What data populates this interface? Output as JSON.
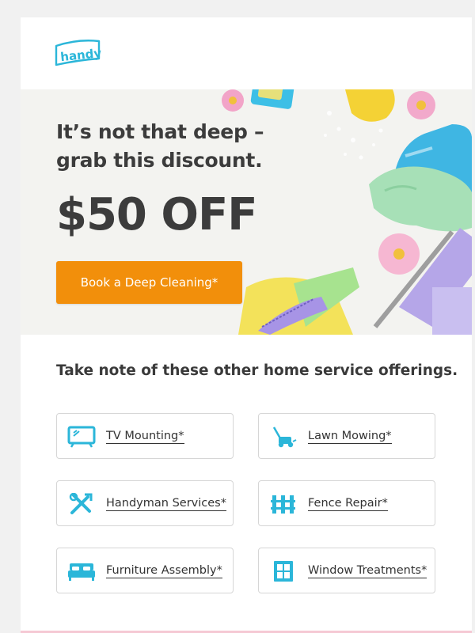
{
  "brand": {
    "name": "handy",
    "color": "#2bb6d9"
  },
  "hero": {
    "headline_line1": "It’s not that deep –",
    "headline_line2": "grab this discount.",
    "offer": "$50 OFF",
    "cta_label": "Book a Deep Cleaning*",
    "cta_color": "#f28f0b"
  },
  "services_section": {
    "title": "Take note of these other home service offerings.",
    "items": [
      {
        "label": "TV Mounting*",
        "icon": "tv-icon"
      },
      {
        "label": "Lawn Mowing*",
        "icon": "lawn-mower-icon"
      },
      {
        "label": "Handyman Services*",
        "icon": "tools-icon"
      },
      {
        "label": "Fence Repair*",
        "icon": "fence-icon"
      },
      {
        "label": "Furniture Assembly*",
        "icon": "bed-icon"
      },
      {
        "label": "Window Treatments*",
        "icon": "window-icon"
      }
    ],
    "icon_color": "#2bb6d9"
  }
}
